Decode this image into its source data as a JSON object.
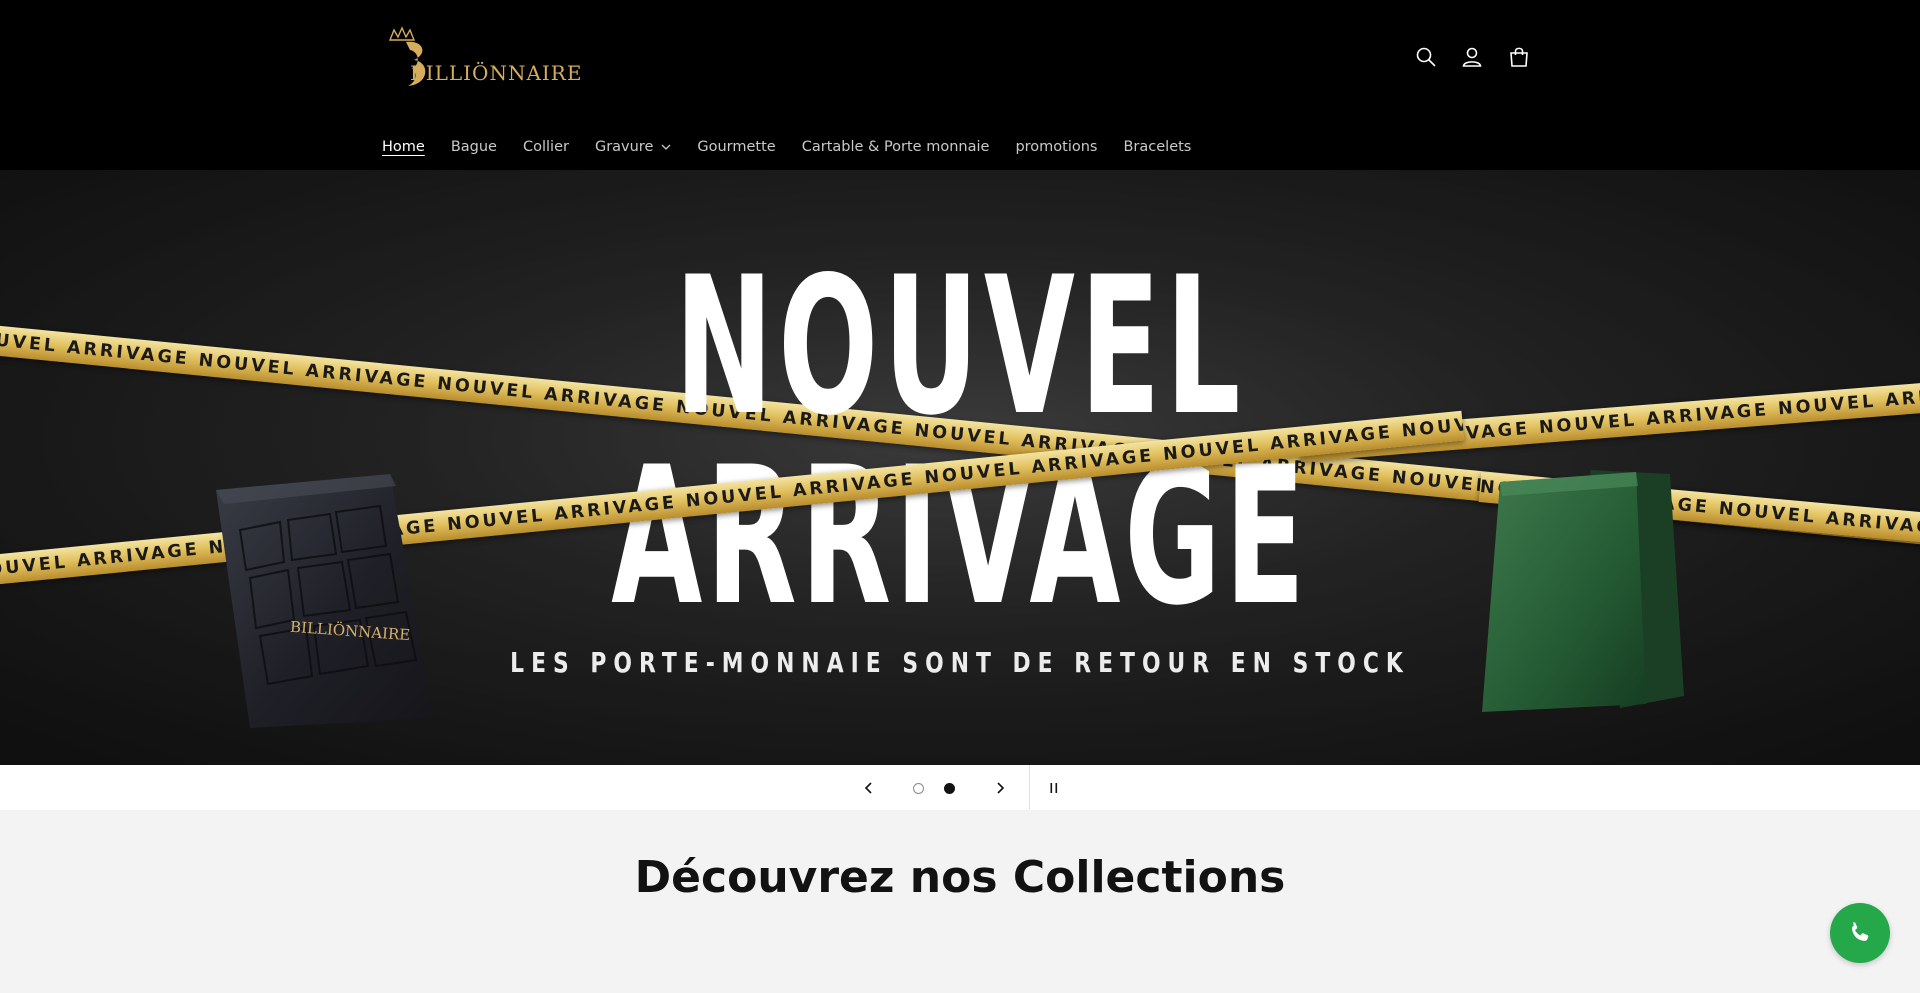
{
  "header": {
    "logo_text": "BILLIÖNNAIRE",
    "icons": {
      "search": "search-icon",
      "account": "account-icon",
      "cart": "cart-icon"
    }
  },
  "nav": {
    "items": [
      {
        "label": "Home",
        "active": true
      },
      {
        "label": "Bague"
      },
      {
        "label": "Collier"
      },
      {
        "label": "Gravure",
        "has_dropdown": true
      },
      {
        "label": "Gourmette"
      },
      {
        "label": "Cartable & Porte monnaie"
      },
      {
        "label": "promotions"
      },
      {
        "label": "Bracelets"
      }
    ]
  },
  "hero": {
    "title_line_1": "NOUVEL",
    "title_line_2": "ARRIVAGE",
    "subtitle": "LES PORTE-MONNAIE SONT DE RETOUR EN STOCK",
    "tape_text": "NOUVEL ARRIVAGE NOUVEL ARRIVAGE NOUVEL ARRIVAGE NOUVEL ARRIVAGE NOUVEL ARRIVAGE NOUVEL ARRIVAGE NOUVEL ARRIVAGE NOUVEL ARRIVAGE NOUVEL ARRIVAGE",
    "wallet_brand": "BILLIÖNNAIRE"
  },
  "slideshow": {
    "slide_count": 2,
    "current_slide": 2,
    "icons": {
      "previous": "chevron-left-icon",
      "next": "chevron-right-icon",
      "pause": "pause-icon"
    }
  },
  "collections": {
    "title": "Découvrez nos Collections"
  },
  "floating": {
    "icon": "whatsapp-phone-icon"
  },
  "colors": {
    "header_bg": "#000000",
    "gold": "#d6ad5c",
    "tape": "#e2c15f",
    "whatsapp_green": "#25a84a",
    "page_bg": "#f3f3f3"
  }
}
